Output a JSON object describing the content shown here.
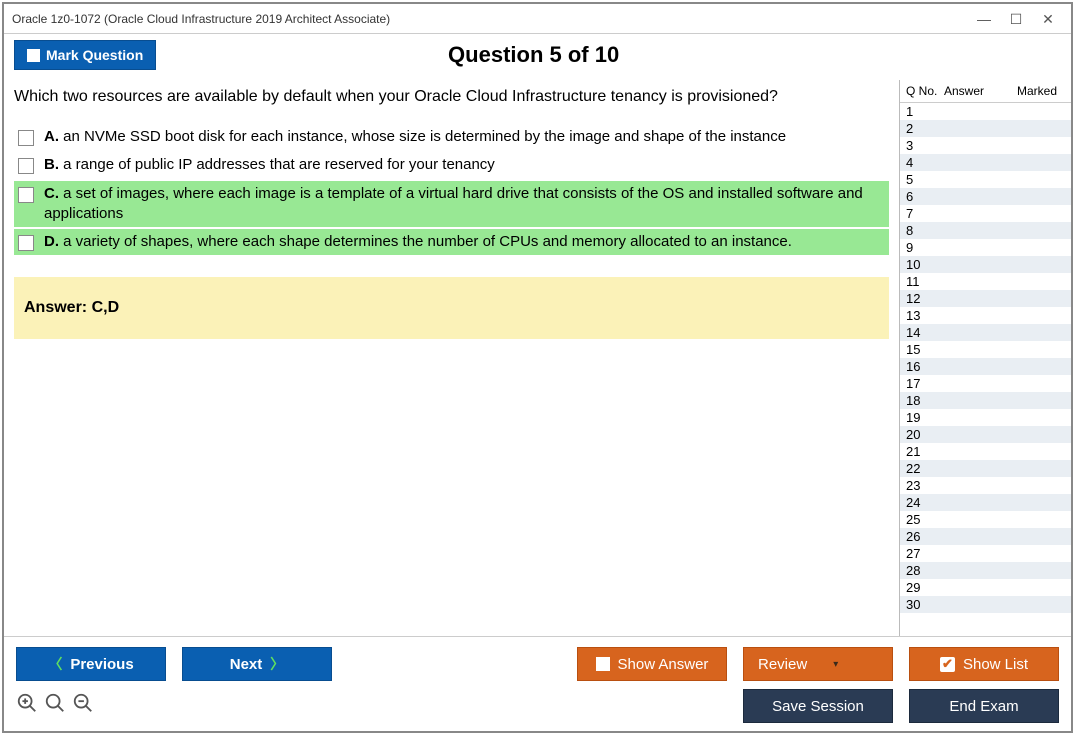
{
  "window": {
    "title": "Oracle 1z0-1072 (Oracle Cloud Infrastructure 2019 Architect Associate)"
  },
  "header": {
    "mark_label": "Mark Question",
    "question_heading": "Question 5 of 10"
  },
  "question": {
    "text": "Which two resources are available by default when your Oracle Cloud Infrastructure tenancy is provisioned?",
    "options": [
      {
        "letter": "A.",
        "text": "an NVMe SSD boot disk for each instance, whose size is determined by the image and shape of the instance",
        "correct": false
      },
      {
        "letter": "B.",
        "text": "a range of public IP addresses that are reserved for your tenancy",
        "correct": false
      },
      {
        "letter": "C.",
        "text": "a set of images, where each image is a template of a virtual hard drive that consists of the OS and installed software and applications",
        "correct": true
      },
      {
        "letter": "D.",
        "text": "a variety of shapes, where each shape determines the number of CPUs and memory allocated to an instance.",
        "correct": true
      }
    ],
    "answer_label": "Answer: C,D"
  },
  "sidepanel": {
    "headers": {
      "qno": "Q No.",
      "answer": "Answer",
      "marked": "Marked"
    },
    "count": 30
  },
  "buttons": {
    "previous": "Previous",
    "next": "Next",
    "show_answer": "Show Answer",
    "review": "Review",
    "show_list": "Show List",
    "save_session": "Save Session",
    "end_exam": "End Exam"
  }
}
